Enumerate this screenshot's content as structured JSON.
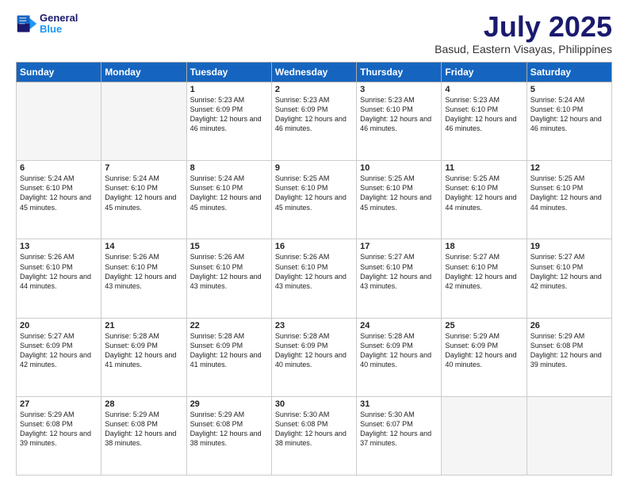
{
  "header": {
    "logo_line1": "General",
    "logo_line2": "Blue",
    "month": "July 2025",
    "location": "Basud, Eastern Visayas, Philippines"
  },
  "days_of_week": [
    "Sunday",
    "Monday",
    "Tuesday",
    "Wednesday",
    "Thursday",
    "Friday",
    "Saturday"
  ],
  "weeks": [
    [
      {
        "day": "",
        "info": ""
      },
      {
        "day": "",
        "info": ""
      },
      {
        "day": "1",
        "info": "Sunrise: 5:23 AM\nSunset: 6:09 PM\nDaylight: 12 hours and 46 minutes."
      },
      {
        "day": "2",
        "info": "Sunrise: 5:23 AM\nSunset: 6:09 PM\nDaylight: 12 hours and 46 minutes."
      },
      {
        "day": "3",
        "info": "Sunrise: 5:23 AM\nSunset: 6:10 PM\nDaylight: 12 hours and 46 minutes."
      },
      {
        "day": "4",
        "info": "Sunrise: 5:23 AM\nSunset: 6:10 PM\nDaylight: 12 hours and 46 minutes."
      },
      {
        "day": "5",
        "info": "Sunrise: 5:24 AM\nSunset: 6:10 PM\nDaylight: 12 hours and 46 minutes."
      }
    ],
    [
      {
        "day": "6",
        "info": "Sunrise: 5:24 AM\nSunset: 6:10 PM\nDaylight: 12 hours and 45 minutes."
      },
      {
        "day": "7",
        "info": "Sunrise: 5:24 AM\nSunset: 6:10 PM\nDaylight: 12 hours and 45 minutes."
      },
      {
        "day": "8",
        "info": "Sunrise: 5:24 AM\nSunset: 6:10 PM\nDaylight: 12 hours and 45 minutes."
      },
      {
        "day": "9",
        "info": "Sunrise: 5:25 AM\nSunset: 6:10 PM\nDaylight: 12 hours and 45 minutes."
      },
      {
        "day": "10",
        "info": "Sunrise: 5:25 AM\nSunset: 6:10 PM\nDaylight: 12 hours and 45 minutes."
      },
      {
        "day": "11",
        "info": "Sunrise: 5:25 AM\nSunset: 6:10 PM\nDaylight: 12 hours and 44 minutes."
      },
      {
        "day": "12",
        "info": "Sunrise: 5:25 AM\nSunset: 6:10 PM\nDaylight: 12 hours and 44 minutes."
      }
    ],
    [
      {
        "day": "13",
        "info": "Sunrise: 5:26 AM\nSunset: 6:10 PM\nDaylight: 12 hours and 44 minutes."
      },
      {
        "day": "14",
        "info": "Sunrise: 5:26 AM\nSunset: 6:10 PM\nDaylight: 12 hours and 43 minutes."
      },
      {
        "day": "15",
        "info": "Sunrise: 5:26 AM\nSunset: 6:10 PM\nDaylight: 12 hours and 43 minutes."
      },
      {
        "day": "16",
        "info": "Sunrise: 5:26 AM\nSunset: 6:10 PM\nDaylight: 12 hours and 43 minutes."
      },
      {
        "day": "17",
        "info": "Sunrise: 5:27 AM\nSunset: 6:10 PM\nDaylight: 12 hours and 43 minutes."
      },
      {
        "day": "18",
        "info": "Sunrise: 5:27 AM\nSunset: 6:10 PM\nDaylight: 12 hours and 42 minutes."
      },
      {
        "day": "19",
        "info": "Sunrise: 5:27 AM\nSunset: 6:10 PM\nDaylight: 12 hours and 42 minutes."
      }
    ],
    [
      {
        "day": "20",
        "info": "Sunrise: 5:27 AM\nSunset: 6:09 PM\nDaylight: 12 hours and 42 minutes."
      },
      {
        "day": "21",
        "info": "Sunrise: 5:28 AM\nSunset: 6:09 PM\nDaylight: 12 hours and 41 minutes."
      },
      {
        "day": "22",
        "info": "Sunrise: 5:28 AM\nSunset: 6:09 PM\nDaylight: 12 hours and 41 minutes."
      },
      {
        "day": "23",
        "info": "Sunrise: 5:28 AM\nSunset: 6:09 PM\nDaylight: 12 hours and 40 minutes."
      },
      {
        "day": "24",
        "info": "Sunrise: 5:28 AM\nSunset: 6:09 PM\nDaylight: 12 hours and 40 minutes."
      },
      {
        "day": "25",
        "info": "Sunrise: 5:29 AM\nSunset: 6:09 PM\nDaylight: 12 hours and 40 minutes."
      },
      {
        "day": "26",
        "info": "Sunrise: 5:29 AM\nSunset: 6:08 PM\nDaylight: 12 hours and 39 minutes."
      }
    ],
    [
      {
        "day": "27",
        "info": "Sunrise: 5:29 AM\nSunset: 6:08 PM\nDaylight: 12 hours and 39 minutes."
      },
      {
        "day": "28",
        "info": "Sunrise: 5:29 AM\nSunset: 6:08 PM\nDaylight: 12 hours and 38 minutes."
      },
      {
        "day": "29",
        "info": "Sunrise: 5:29 AM\nSunset: 6:08 PM\nDaylight: 12 hours and 38 minutes."
      },
      {
        "day": "30",
        "info": "Sunrise: 5:30 AM\nSunset: 6:08 PM\nDaylight: 12 hours and 38 minutes."
      },
      {
        "day": "31",
        "info": "Sunrise: 5:30 AM\nSunset: 6:07 PM\nDaylight: 12 hours and 37 minutes."
      },
      {
        "day": "",
        "info": ""
      },
      {
        "day": "",
        "info": ""
      }
    ]
  ]
}
